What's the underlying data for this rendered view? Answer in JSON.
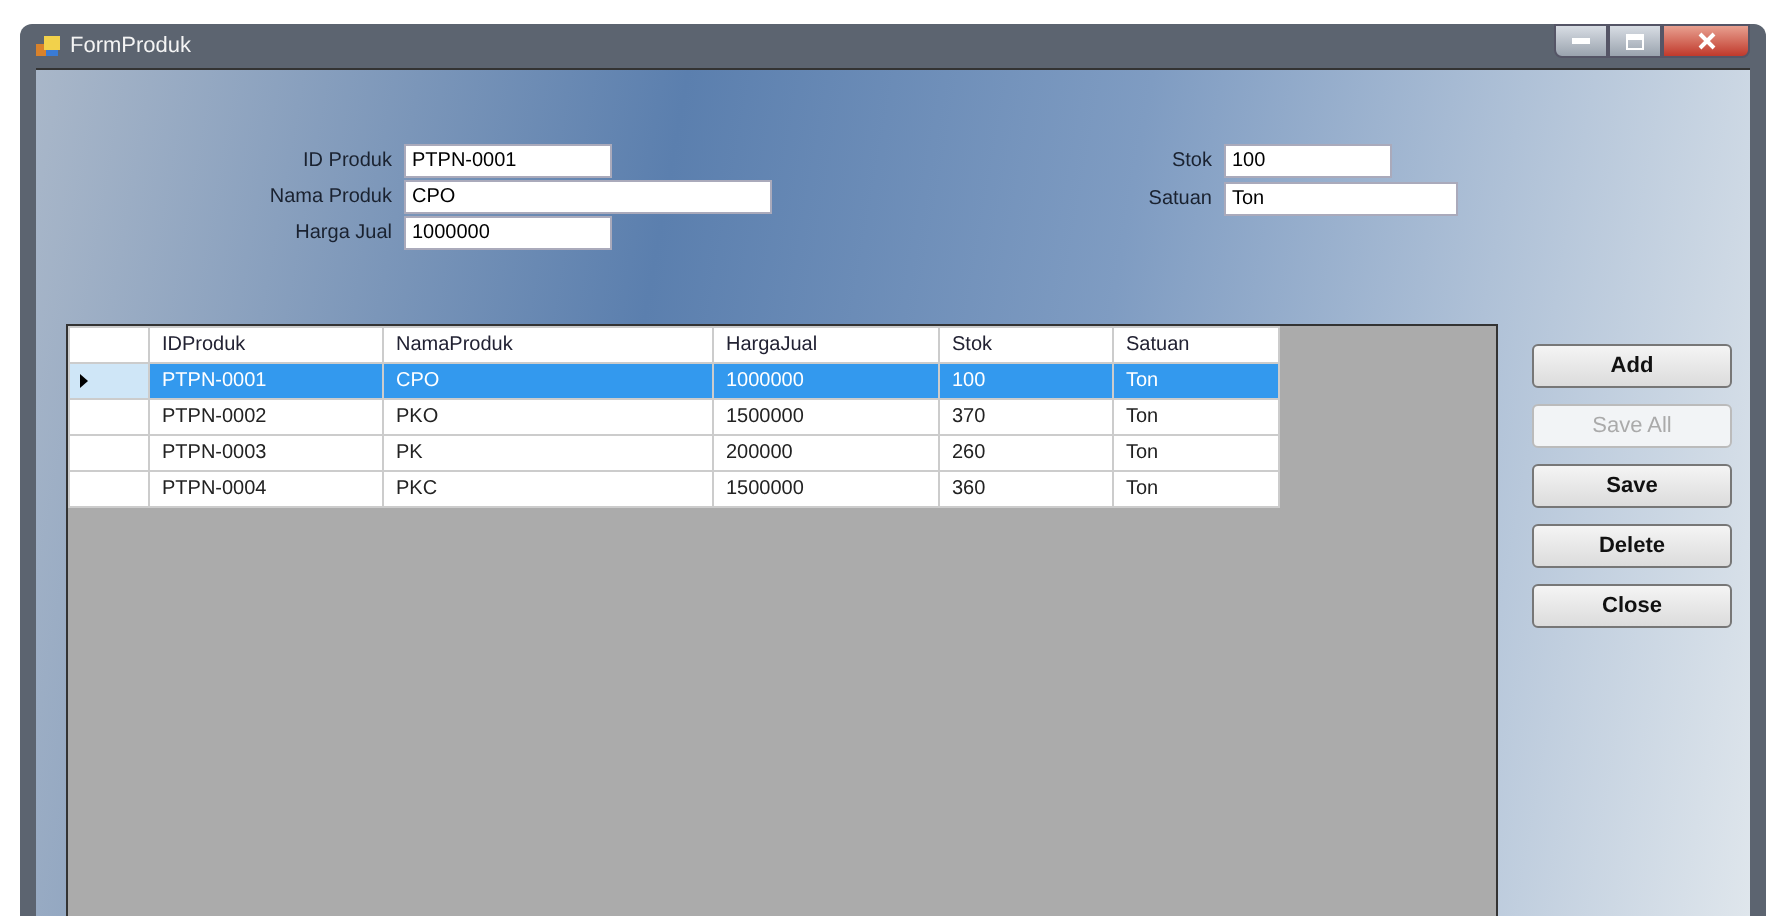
{
  "window": {
    "title": "FormProduk"
  },
  "fields_left": [
    {
      "label": "ID Produk",
      "value": "PTPN-0001"
    },
    {
      "label": "Nama Produk",
      "value": "CPO"
    },
    {
      "label": "Harga Jual",
      "value": "1000000"
    }
  ],
  "fields_right": [
    {
      "label": "Stok",
      "value": "100"
    },
    {
      "label": "Satuan",
      "value": "Ton"
    }
  ],
  "table": {
    "columns": [
      "IDProduk",
      "NamaProduk",
      "HargaJual",
      "Stok",
      "Satuan"
    ],
    "rows": [
      {
        "cells": [
          "PTPN-0001",
          "CPO",
          "1000000",
          "100",
          "Ton"
        ],
        "selected": true
      },
      {
        "cells": [
          "PTPN-0002",
          "PKO",
          "1500000",
          "370",
          "Ton"
        ],
        "selected": false
      },
      {
        "cells": [
          "PTPN-0003",
          "PK",
          "200000",
          "260",
          "Ton"
        ],
        "selected": false
      },
      {
        "cells": [
          "PTPN-0004",
          "PKC",
          "1500000",
          "360",
          "Ton"
        ],
        "selected": false
      }
    ]
  },
  "buttons": [
    {
      "label": "Add",
      "disabled": false
    },
    {
      "label": "Save All",
      "disabled": true
    },
    {
      "label": "Save",
      "disabled": false
    },
    {
      "label": "Delete",
      "disabled": false
    },
    {
      "label": "Close",
      "disabled": false
    }
  ]
}
